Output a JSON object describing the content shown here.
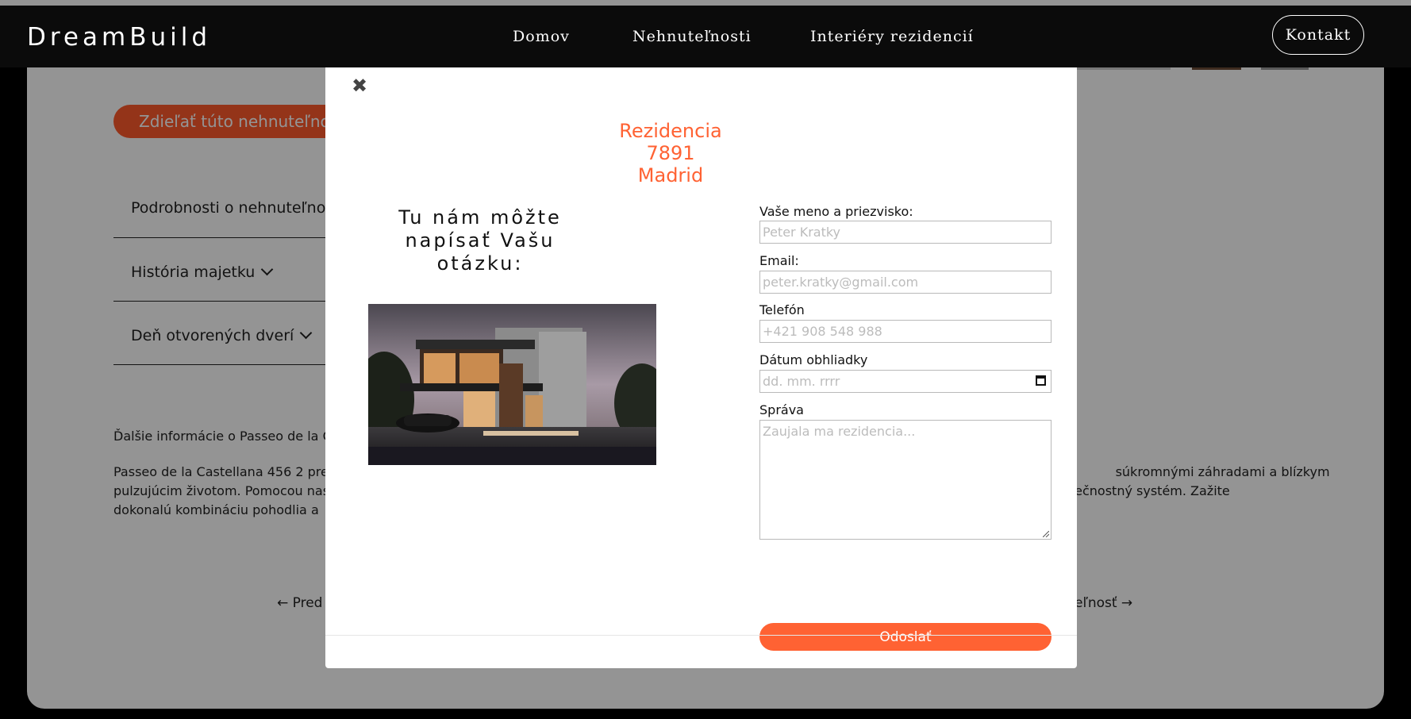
{
  "header": {
    "brand": "DreamBuild",
    "nav": [
      "Domov",
      "Nehnuteľnosti",
      "Interiéry rezidencií"
    ],
    "contact_label": "Kontakt"
  },
  "page": {
    "share_label": "Zdieľať túto nehnuteľnosť",
    "accordion": [
      {
        "label": "Podrobnosti o nehnuteľnosti"
      },
      {
        "label": "História majetku"
      },
      {
        "label": "Deň otvorených dverí"
      }
    ],
    "info_heading": "Ďalšie informácie o Passeo de la C",
    "paragraph_lines": [
      "Passeo de la Castellana 456 2 pre                                                                                                                                                                                                   súkromnými záhradami a blízkym",
      "pulzujúcim životom. Pomocou nas                                                                                                                                                                                     zpečnostný systém. Zažite",
      "dokonalú kombináciu pohodlia a"
    ],
    "prev_label": "← Pred",
    "next_label": "eľnosť →"
  },
  "modal": {
    "close_icon": "close-x-icon",
    "title_lines": [
      "Rezidencia",
      "7891",
      "Madrid"
    ],
    "subheading_lines": [
      "Tu nám môžte",
      "napísať Vašu",
      "otázku:"
    ],
    "form": {
      "name_label": "Vaše meno a priezvisko:",
      "name_placeholder": "Peter Kratky",
      "email_label": "Email:",
      "email_placeholder": "peter.kratky@gmail.com",
      "phone_label": "Telefón",
      "phone_placeholder": "+421 908 548 988",
      "date_label": "Dátum obhliadky",
      "date_placeholder": "dd. mm. rrrr",
      "message_label": "Správa",
      "message_placeholder": "Zaujala ma rezidencia...",
      "submit_label": "Odoslať"
    }
  },
  "colors": {
    "accent": "#ff6233",
    "header_bg": "#0b0b0b",
    "overlay": "rgba(0,0,0,0.42)"
  }
}
